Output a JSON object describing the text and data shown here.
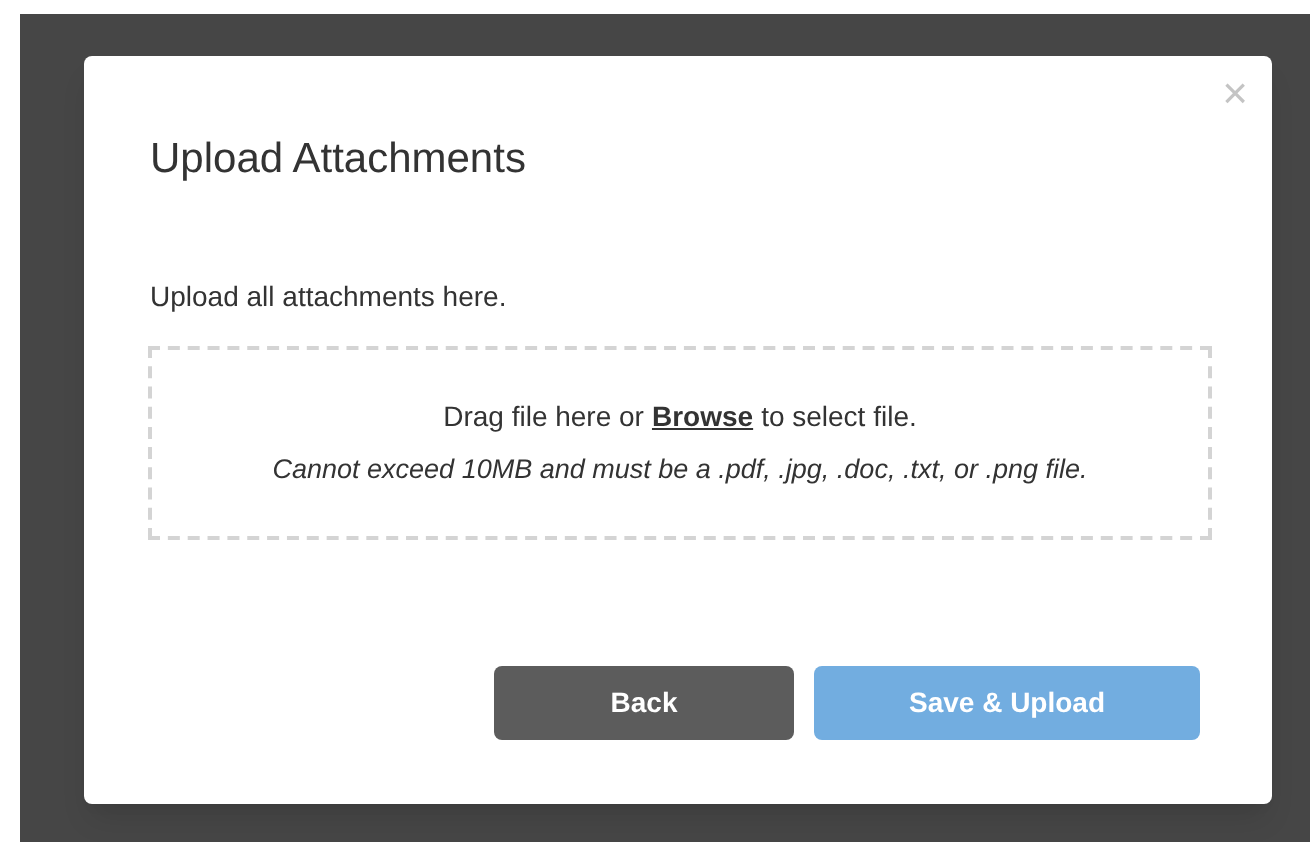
{
  "dialog": {
    "title": "Upload Attachments",
    "close": "×",
    "instructions": "Upload all attachments here.",
    "drop_zone": {
      "line_1_before": "Drag file here or",
      "link": "Browse",
      "line_1_after": "to select file.",
      "line_2": "Cannot exceed 10MB and must be a .pdf, .jpg, .doc, .txt, or .png file."
    },
    "buttons": [
      {
        "label": "Back",
        "kind": "secondary",
        "disabled": false
      },
      {
        "label": "Save & Upload",
        "kind": "primary",
        "disabled": true
      }
    ]
  }
}
